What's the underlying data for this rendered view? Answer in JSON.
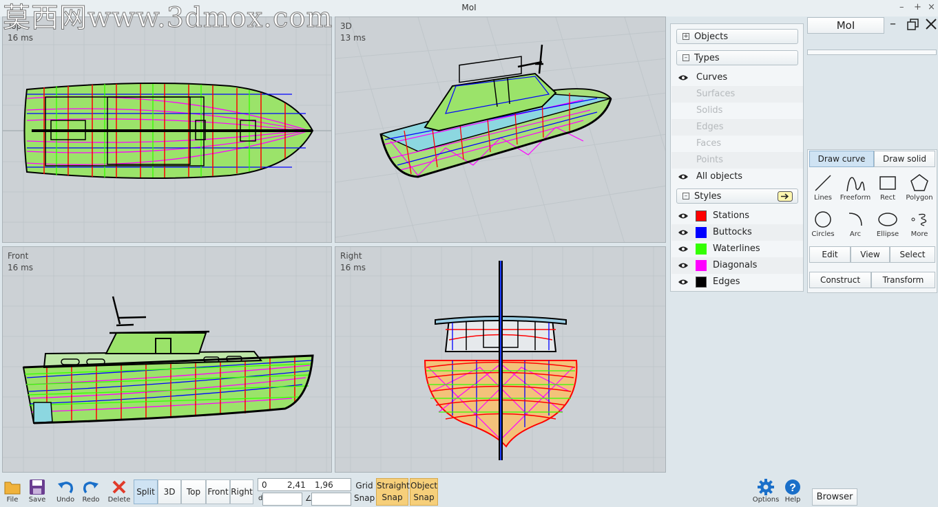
{
  "window": {
    "title": "MoI",
    "watermark": "莫西网www.3dmox.com"
  },
  "viewports": [
    {
      "name": "Top",
      "ms": "16 ms"
    },
    {
      "name": "3D",
      "ms": "13 ms"
    },
    {
      "name": "Front",
      "ms": "16 ms"
    },
    {
      "name": "Right",
      "ms": "16 ms"
    }
  ],
  "scene_panel": {
    "objects_label": "Objects",
    "types_label": "Types",
    "types": [
      {
        "label": "Curves",
        "visible": true,
        "enabled": true
      },
      {
        "label": "Surfaces",
        "visible": false,
        "enabled": false
      },
      {
        "label": "Solids",
        "visible": false,
        "enabled": false
      },
      {
        "label": "Edges",
        "visible": false,
        "enabled": false
      },
      {
        "label": "Faces",
        "visible": false,
        "enabled": false
      },
      {
        "label": "Points",
        "visible": false,
        "enabled": false
      },
      {
        "label": "All objects",
        "visible": true,
        "enabled": true
      }
    ],
    "styles_label": "Styles",
    "styles": [
      {
        "label": "Stations",
        "color": "#ff0000"
      },
      {
        "label": "Buttocks",
        "color": "#0000ff"
      },
      {
        "label": "Waterlines",
        "color": "#33ff00"
      },
      {
        "label": "Diagonals",
        "color": "#ff00ff"
      },
      {
        "label": "Edges",
        "color": "#000000"
      }
    ]
  },
  "side_panel": {
    "app_button": "MoI",
    "tabs": {
      "draw_curve": "Draw curve",
      "draw_solid": "Draw solid"
    },
    "tools": [
      {
        "label": "Lines",
        "icon": "lines-icon"
      },
      {
        "label": "Freeform",
        "icon": "freeform-icon"
      },
      {
        "label": "Rect",
        "icon": "rect-icon"
      },
      {
        "label": "Polygon",
        "icon": "polygon-icon"
      },
      {
        "label": "Circles",
        "icon": "circle-icon"
      },
      {
        "label": "Arc",
        "icon": "arc-icon"
      },
      {
        "label": "Ellipse",
        "icon": "ellipse-icon"
      },
      {
        "label": "More",
        "icon": "more-icon"
      }
    ],
    "row1": {
      "edit": "Edit",
      "view": "View",
      "select": "Select"
    },
    "row2": {
      "construct": "Construct",
      "transform": "Transform"
    }
  },
  "bottom_bar": {
    "file": "File",
    "save": "Save",
    "undo": "Undo",
    "redo": "Redo",
    "delete": "Delete",
    "views": {
      "split": "Split",
      "3d": "3D",
      "top": "Top",
      "front": "Front",
      "right": "Right"
    },
    "coords": {
      "x": "0",
      "y": "2,41",
      "z": "1,96",
      "d_label": "d",
      "angle_label": "∠"
    },
    "grid_snap": {
      "line1": "Grid",
      "line2": "Snap"
    },
    "straight_snap": {
      "line1": "Straight",
      "line2": "Snap"
    },
    "object_snap": {
      "line1": "Object",
      "line2": "Snap"
    },
    "options": "Options",
    "help": "Help",
    "browser": "Browser"
  },
  "colors": {
    "stations": "#ff0000",
    "buttocks": "#0000ff",
    "waterlines": "#33ff00",
    "diagonals": "#ff00ff",
    "edges": "#000000",
    "active_tab": "#cfe3f3",
    "snap_active": "#f6cf7a"
  }
}
